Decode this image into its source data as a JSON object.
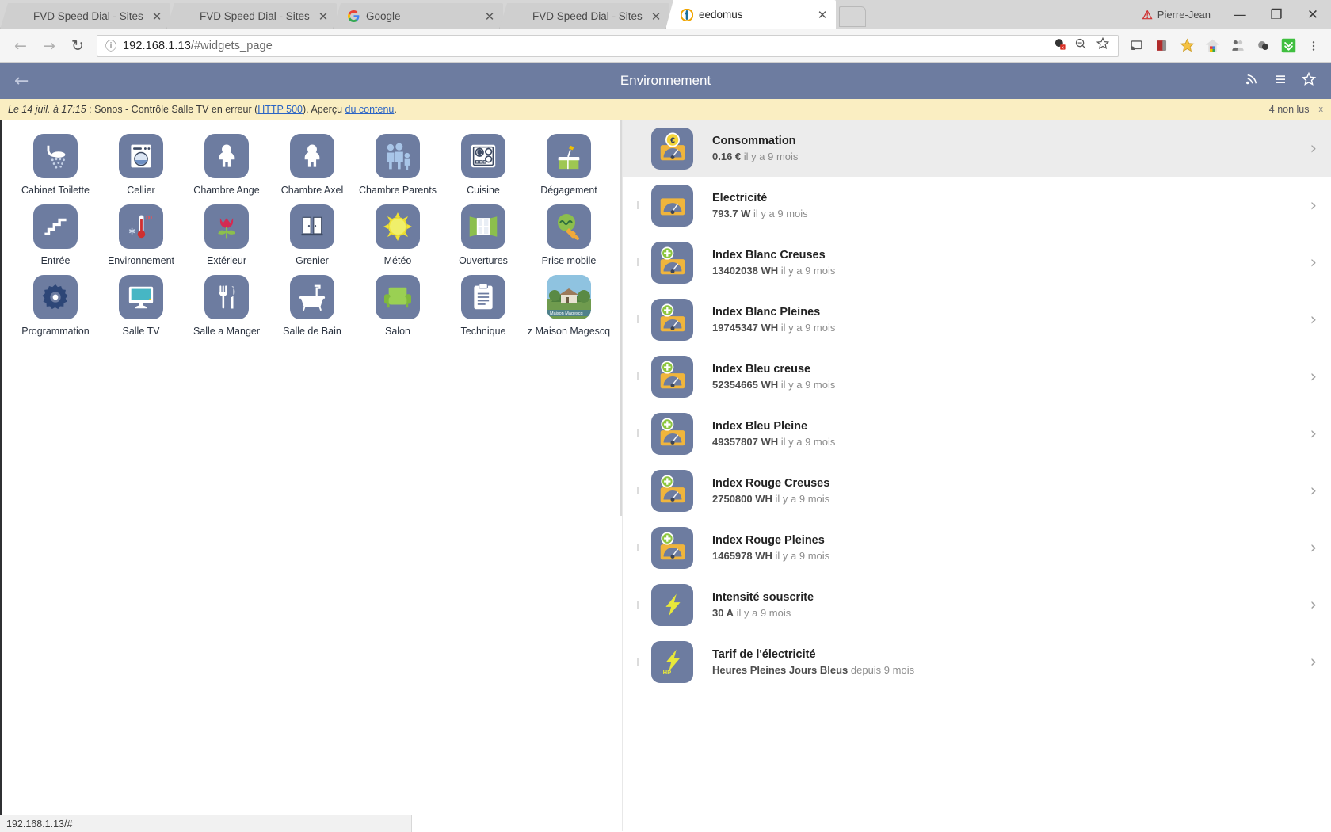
{
  "browser": {
    "tabs": [
      {
        "title": "FVD Speed Dial - Sites",
        "favicon": "",
        "active": false
      },
      {
        "title": "FVD Speed Dial - Sites",
        "favicon": "",
        "active": false
      },
      {
        "title": "Google",
        "favicon": "google-icon",
        "active": false
      },
      {
        "title": "FVD Speed Dial - Sites",
        "favicon": "",
        "active": false
      },
      {
        "title": "eedomus",
        "favicon": "eedomus-icon",
        "active": true
      }
    ],
    "close_label": "✕",
    "profile_name": "Pierre-Jean",
    "window_controls": {
      "minimize": "—",
      "maximize": "❐",
      "close": "✕"
    },
    "nav": {
      "back": "←",
      "forward": "→",
      "reload": "↻"
    },
    "url": "192.168.1.13/#widgets_page",
    "url_host": "192.168.1.13",
    "url_path": "/#widgets_page",
    "info_icon": "ⓘ",
    "omni_icons": [
      "adblock-icon",
      "zoom-out-icon",
      "bookmark-star-icon"
    ],
    "extension_icons": [
      "cast-icon",
      "pocket-icon",
      "star-icon",
      "home-colored-icon",
      "people-icon",
      "dark-icon",
      "download-icon",
      "menu-icon"
    ],
    "status_text": "192.168.1.13/#"
  },
  "app_header": {
    "back_icon": "←",
    "title": "Environnement",
    "right_icons": [
      "signal-icon",
      "hamburger-icon",
      "star-icon"
    ]
  },
  "notice": {
    "prefix": "Le 14 juil. à 17:15",
    "text_1": " : Sonos - Contrôle Salle TV en erreur (",
    "link_1": "HTTP 500",
    "text_2": "). Aperçu ",
    "link_2": "du contenu",
    "text_3": ".",
    "unread": "4 non lus",
    "close": "x"
  },
  "tiles": [
    {
      "label": "Cabinet Toilette",
      "icon": "shower-icon"
    },
    {
      "label": "Cellier",
      "icon": "washing-machine-icon"
    },
    {
      "label": "Chambre Ange",
      "icon": "baby-icon"
    },
    {
      "label": "Chambre Axel",
      "icon": "baby-icon"
    },
    {
      "label": "Chambre Parents",
      "icon": "family-icon"
    },
    {
      "label": "Cuisine",
      "icon": "cooktop-icon"
    },
    {
      "label": "Dégagement",
      "icon": "desk-lamp-icon"
    },
    {
      "label": "Entrée",
      "icon": "stairs-icon"
    },
    {
      "label": "Environnement",
      "icon": "thermometer-icon"
    },
    {
      "label": "Extérieur",
      "icon": "tulip-icon"
    },
    {
      "label": "Grenier",
      "icon": "doors-icon"
    },
    {
      "label": "Météo",
      "icon": "sun-icon"
    },
    {
      "label": "Ouvertures",
      "icon": "window-icon"
    },
    {
      "label": "Prise mobile",
      "icon": "plug-icon"
    },
    {
      "label": "Programmation",
      "icon": "gear-icon"
    },
    {
      "label": "Salle TV",
      "icon": "monitor-icon"
    },
    {
      "label": "Salle a Manger",
      "icon": "cutlery-icon"
    },
    {
      "label": "Salle de Bain",
      "icon": "bathtub-icon"
    },
    {
      "label": "Salon",
      "icon": "armchair-icon"
    },
    {
      "label": "Technique",
      "icon": "clipboard-icon"
    },
    {
      "label": "z Maison Magescq",
      "icon": "house-photo-icon",
      "photo_caption": "Maison Magescq"
    }
  ],
  "device_list": [
    {
      "title": "Consommation",
      "value": "0.16 €",
      "time": "il y a 9 mois",
      "icon": "gauge-euro-icon",
      "highlight": true
    },
    {
      "title": "Electricité",
      "value": "793.7 W",
      "time": "il y a 9 mois",
      "icon": "gauge-icon",
      "highlight": false
    },
    {
      "title": "Index Blanc Creuses",
      "value": "13402038 WH",
      "time": "il y a 9 mois",
      "icon": "gauge-plus-icon",
      "highlight": false
    },
    {
      "title": "Index Blanc Pleines",
      "value": "19745347 WH",
      "time": "il y a 9 mois",
      "icon": "gauge-plus-icon",
      "highlight": false
    },
    {
      "title": "Index Bleu creuse",
      "value": "52354665 WH",
      "time": "il y a 9 mois",
      "icon": "gauge-plus-icon",
      "highlight": false
    },
    {
      "title": "Index Bleu Pleine",
      "value": "49357807 WH",
      "time": "il y a 9 mois",
      "icon": "gauge-plus-icon",
      "highlight": false
    },
    {
      "title": "Index Rouge Creuses",
      "value": "2750800 WH",
      "time": "il y a 9 mois",
      "icon": "gauge-plus-icon",
      "highlight": false
    },
    {
      "title": "Index Rouge Pleines",
      "value": "1465978 WH",
      "time": "il y a 9 mois",
      "icon": "gauge-plus-icon",
      "highlight": false
    },
    {
      "title": "Intensité souscrite",
      "value": "30 A",
      "time": "il y a 9 mois",
      "icon": "bolt-icon",
      "highlight": false
    },
    {
      "title": "Tarif de l'électricité",
      "value": "Heures Pleines Jours Bleus",
      "time": "depuis 9 mois",
      "icon": "bolt-hp-icon",
      "highlight": false
    }
  ],
  "chevron": "›",
  "colors": {
    "app_accent": "#6d7ca0",
    "notice_bg": "#faeec2",
    "link": "#2b64c4",
    "highlight_row": "#ececec",
    "icon_yellow": "#f5b942",
    "icon_green": "#7cc04a"
  }
}
